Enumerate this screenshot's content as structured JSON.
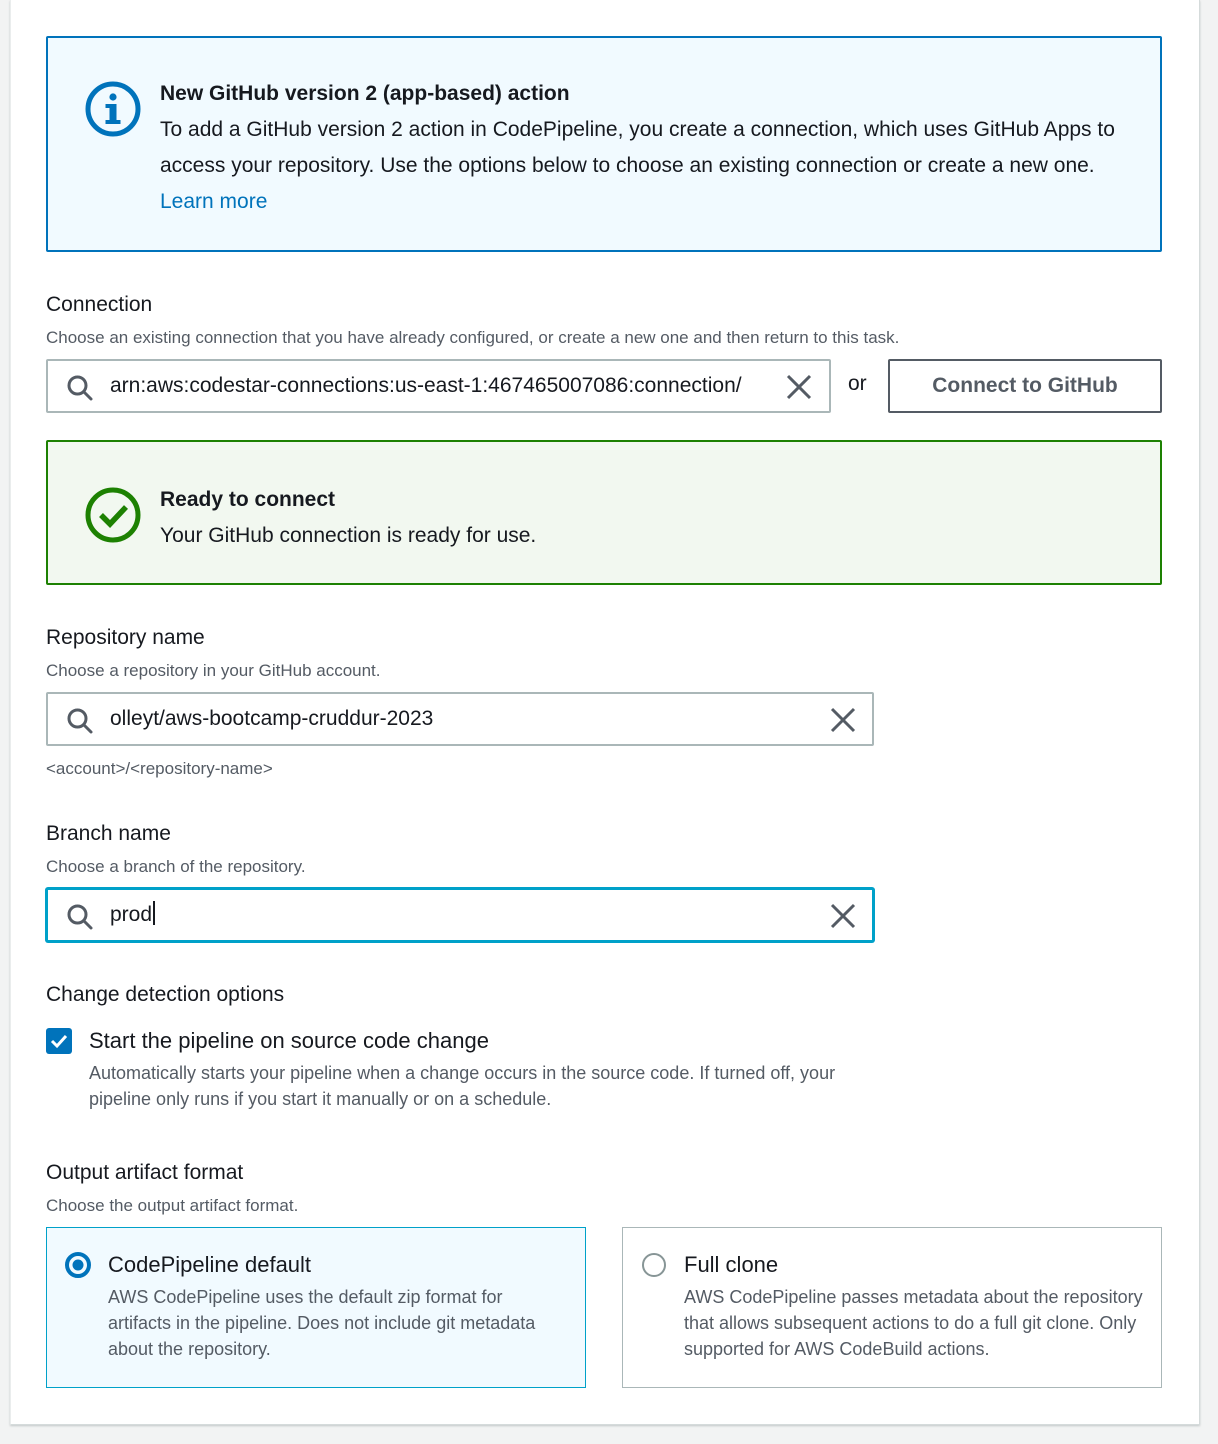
{
  "info_alert": {
    "title": "New GitHub version 2 (app-based) action",
    "body": "To add a GitHub version 2 action in CodePipeline, you create a connection, which uses GitHub Apps to access your repository. Use the options below to choose an existing connection or create a new one.",
    "link": "Learn more"
  },
  "connection": {
    "label": "Connection",
    "description": "Choose an existing connection that you have already configured, or create a new one and then return to this task.",
    "value": "arn:aws:codestar-connections:us-east-1:467465007086:connection/",
    "or_text": "or",
    "button": "Connect to GitHub"
  },
  "success_alert": {
    "title": "Ready to connect",
    "body": "Your GitHub connection is ready for use."
  },
  "repository": {
    "label": "Repository name",
    "description": "Choose a repository in your GitHub account.",
    "value": "olleyt/aws-bootcamp-cruddur-2023",
    "hint": "<account>/<repository-name>"
  },
  "branch": {
    "label": "Branch name",
    "description": "Choose a branch of the repository.",
    "value": "prod"
  },
  "change_detection": {
    "label": "Change detection options",
    "checkbox_label": "Start the pipeline on source code change",
    "checkbox_description": "Automatically starts your pipeline when a change occurs in the source code. If turned off, your pipeline only runs if you start it manually or on a schedule.",
    "checked": true
  },
  "output_format": {
    "label": "Output artifact format",
    "description": "Choose the output artifact format.",
    "options": [
      {
        "title": "CodePipeline default",
        "description": "AWS CodePipeline uses the default zip format for artifacts in the pipeline. Does not include git metadata about the repository.",
        "selected": true
      },
      {
        "title": "Full clone",
        "description": "AWS CodePipeline passes metadata about the repository that allows subsequent actions to do a full git clone. Only supported for AWS CodeBuild actions.",
        "selected": false
      }
    ]
  },
  "colors": {
    "info_border": "#0073bb",
    "success_border": "#1d8102",
    "focus": "#00a1c9",
    "link": "#0073bb"
  },
  "icons": [
    "info-icon",
    "success-check-icon",
    "search-icon",
    "clear-icon",
    "checkbox-checked-icon",
    "radio-selected-icon",
    "radio-unselected-icon"
  ]
}
